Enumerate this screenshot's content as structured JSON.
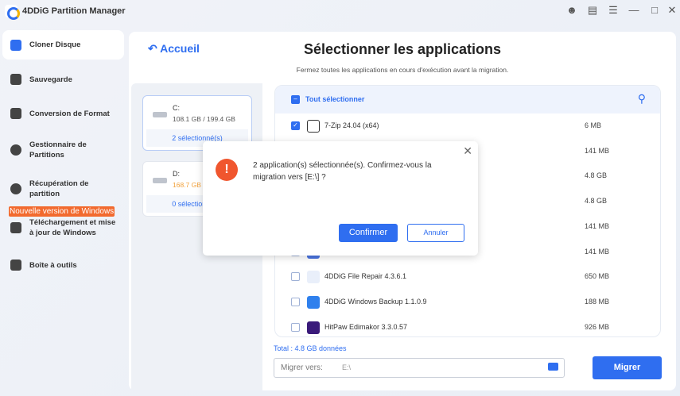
{
  "app": {
    "title": "4DDiG Partition Manager"
  },
  "sidebar": {
    "items": [
      {
        "label": "Cloner Disque"
      },
      {
        "label": "Sauvegarde"
      },
      {
        "label": "Conversion de Format"
      },
      {
        "label": "Gestionnaire de Partitions"
      },
      {
        "label": "Récupération de partition"
      },
      {
        "label": "Téléchargement et mise à jour de Windows"
      },
      {
        "label": "Boîte à outils"
      }
    ],
    "badge": "Nouvelle version de Windows"
  },
  "main": {
    "back": "Accueil",
    "title": "Sélectionner les applications",
    "subtitle": "Fermez toutes les applications en cours d'exécution avant la migration.",
    "disks": [
      {
        "name": "C:",
        "size": "108.1 GB / 199.4 GB",
        "count": "2 sélectionné(s)"
      },
      {
        "name": "D:",
        "size": "168.7 GB",
        "count": "0 sélectionné(s)"
      }
    ],
    "select_all": "Tout sélectionner",
    "apps": [
      {
        "name": "7-Zip 24.04 (x64)",
        "size": "6 MB",
        "checked": true
      },
      {
        "name": "",
        "size": "141 MB"
      },
      {
        "name": "",
        "size": "4.8 GB"
      },
      {
        "name": "",
        "size": "4.8 GB"
      },
      {
        "name": "",
        "size": "141 MB"
      },
      {
        "name": "",
        "size": "141 MB"
      },
      {
        "name": "4DDiG File Repair 4.3.6.1",
        "size": "650 MB"
      },
      {
        "name": "4DDiG Windows Backup 1.1.0.9",
        "size": "188 MB"
      },
      {
        "name": "HitPaw Edimakor 3.3.0.57",
        "size": "926 MB"
      }
    ],
    "total": "Total : 4.8 GB données",
    "dest_label": "Migrer vers:",
    "dest_value": "E:\\",
    "migrate": "Migrer"
  },
  "dialog": {
    "message": "2 application(s) sélectionnée(s). Confirmez-vous la migration vers [E:\\] ?",
    "confirm": "Confirmer",
    "cancel": "Annuler"
  }
}
